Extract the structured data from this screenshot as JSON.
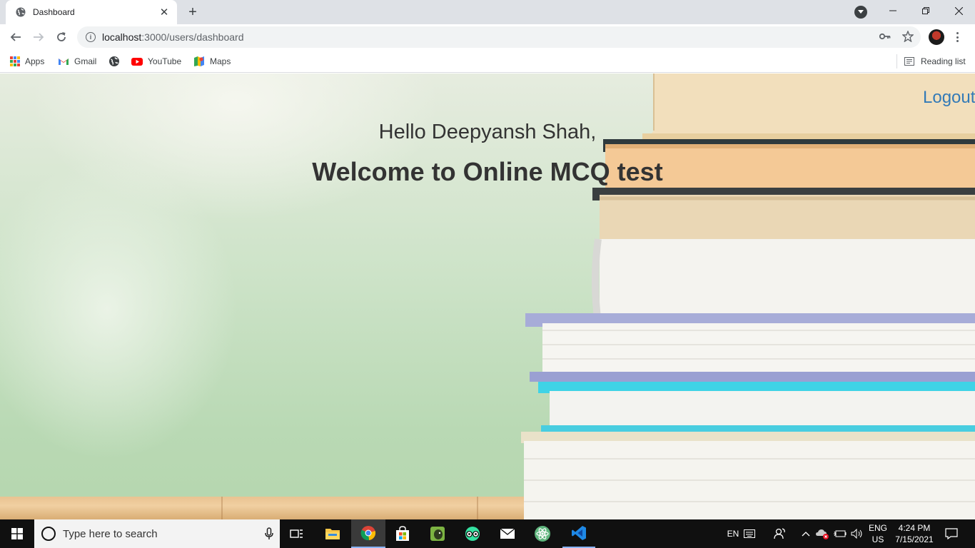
{
  "browser": {
    "tab": {
      "title": "Dashboard"
    },
    "url": {
      "host": "localhost",
      "path": ":3000/users/dashboard"
    },
    "bookmarks": [
      {
        "label": "Apps",
        "icon": "apps-grid-icon"
      },
      {
        "label": "Gmail",
        "icon": "gmail-icon"
      },
      {
        "label": "",
        "icon": "globe-icon"
      },
      {
        "label": "YouTube",
        "icon": "youtube-icon"
      },
      {
        "label": "Maps",
        "icon": "maps-icon"
      }
    ],
    "reading_list_label": "Reading list"
  },
  "page": {
    "logout_label": "Logout",
    "greeting": "Hello Deepyansh Shah,",
    "welcome": "Welcome to Online MCQ test",
    "colors": {
      "link": "#337ab7",
      "text": "#333333"
    }
  },
  "taskbar": {
    "search_placeholder": "Type here to search",
    "input_indicator": "EN",
    "language": "ENG",
    "region": "US",
    "time": "4:24 PM",
    "date": "7/15/2021",
    "pinned_apps": [
      "task-view",
      "file-explorer",
      "chrome",
      "microsoft-store",
      "evernote",
      "tripadvisor",
      "mail",
      "atom",
      "vscode"
    ]
  }
}
